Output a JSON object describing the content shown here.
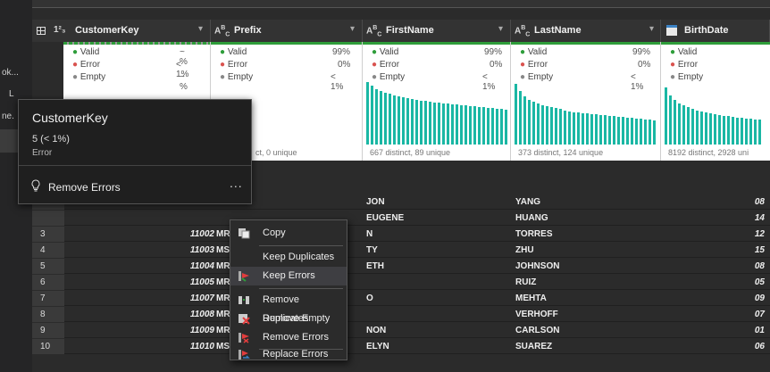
{
  "left_panel": {
    "texts": [
      "ok...",
      "L",
      "ne."
    ]
  },
  "columns": [
    {
      "type": "1²₃",
      "name": "CustomerKey",
      "has_grid_icon": true
    },
    {
      "type": "A^B_C",
      "name": "Prefix"
    },
    {
      "type": "A^B_C",
      "name": "FirstName"
    },
    {
      "type": "A^B_C",
      "name": "LastName"
    },
    {
      "type": "calendar",
      "name": "BirthDate"
    }
  ],
  "profiles": [
    {
      "valid": "• Valid",
      "error": "• Error",
      "empty": "• Empty",
      "valid_pct": "~ %",
      "error_pct": "< 1%",
      "empty_pct": "~ %",
      "distinct": ""
    },
    {
      "valid": "• Valid",
      "error": "• Error",
      "empty": "• Empty",
      "valid_pct": "99%",
      "error_pct": "0%",
      "empty_pct": "< 1%",
      "distinct": "ct, 0 unique"
    },
    {
      "valid": "• Valid",
      "error": "• Error",
      "empty": "• Empty",
      "valid_pct": "99%",
      "error_pct": "0%",
      "empty_pct": "< 1%",
      "distinct": "667 distinct, 89 unique"
    },
    {
      "valid": "• Valid",
      "error": "• Error",
      "empty": "• Empty",
      "valid_pct": "99%",
      "error_pct": "0%",
      "empty_pct": "< 1%",
      "distinct": "373 distinct, 124 unique"
    },
    {
      "valid": "• Valid",
      "error": "• Error",
      "empty": "• Empty",
      "valid_pct": "",
      "error_pct": "",
      "empty_pct": "",
      "distinct": "8192 distinct, 2928 uni"
    }
  ],
  "tooltip": {
    "title": "CustomerKey",
    "count": "5 (< 1%)",
    "kind": "Error",
    "action": "Remove Errors",
    "more": "..."
  },
  "rows": [
    {
      "num": "",
      "key": "",
      "prefix": "",
      "first": "JON",
      "last": "YANG",
      "birth": "08"
    },
    {
      "num": "",
      "key": "",
      "prefix": "",
      "first": "EUGENE",
      "last": "HUANG",
      "birth": "14"
    },
    {
      "num": "3",
      "key": "11002",
      "prefix": "MR",
      "first": "N",
      "last": "TORRES",
      "birth": "12"
    },
    {
      "num": "4",
      "key": "11003",
      "prefix": "MS",
      "first": "TY",
      "last": "ZHU",
      "birth": "15"
    },
    {
      "num": "5",
      "key": "11004",
      "prefix": "MR",
      "first": "ETH",
      "last": "JOHNSON",
      "birth": "08"
    },
    {
      "num": "6",
      "key": "11005",
      "prefix": "MR",
      "first": "",
      "last": "RUIZ",
      "birth": "05"
    },
    {
      "num": "7",
      "key": "11007",
      "prefix": "MR",
      "first": "O",
      "last": "MEHTA",
      "birth": "09"
    },
    {
      "num": "8",
      "key": "11008",
      "prefix": "MR",
      "first": "",
      "last": "VERHOFF",
      "birth": "07"
    },
    {
      "num": "9",
      "key": "11009",
      "prefix": "MR",
      "first": "NON",
      "last": "CARLSON",
      "birth": "01"
    },
    {
      "num": "10",
      "key": "11010",
      "prefix": "MS",
      "first": "ELYN",
      "last": "SUAREZ",
      "birth": "06"
    }
  ],
  "context_menu": [
    {
      "label": "Copy",
      "icon": "copy-icon"
    },
    {
      "label": "Keep Duplicates",
      "icon": ""
    },
    {
      "label": "Keep Errors",
      "icon": "keep-errors-icon",
      "highlighted": true
    },
    {
      "label": "Remove Duplicates",
      "icon": "remove-duplicates-icon"
    },
    {
      "label": "Remove Empty",
      "icon": "remove-empty-icon"
    },
    {
      "label": "Remove Errors",
      "icon": "remove-errors-icon"
    },
    {
      "label": "Replace Errors",
      "icon": "replace-errors-icon"
    }
  ],
  "colors": {
    "valid": "#2e9d3a",
    "error": "#d9534f",
    "empty": "#888888",
    "histogram": "#1ab7a4",
    "menu_highlight": "#3e3e42"
  }
}
